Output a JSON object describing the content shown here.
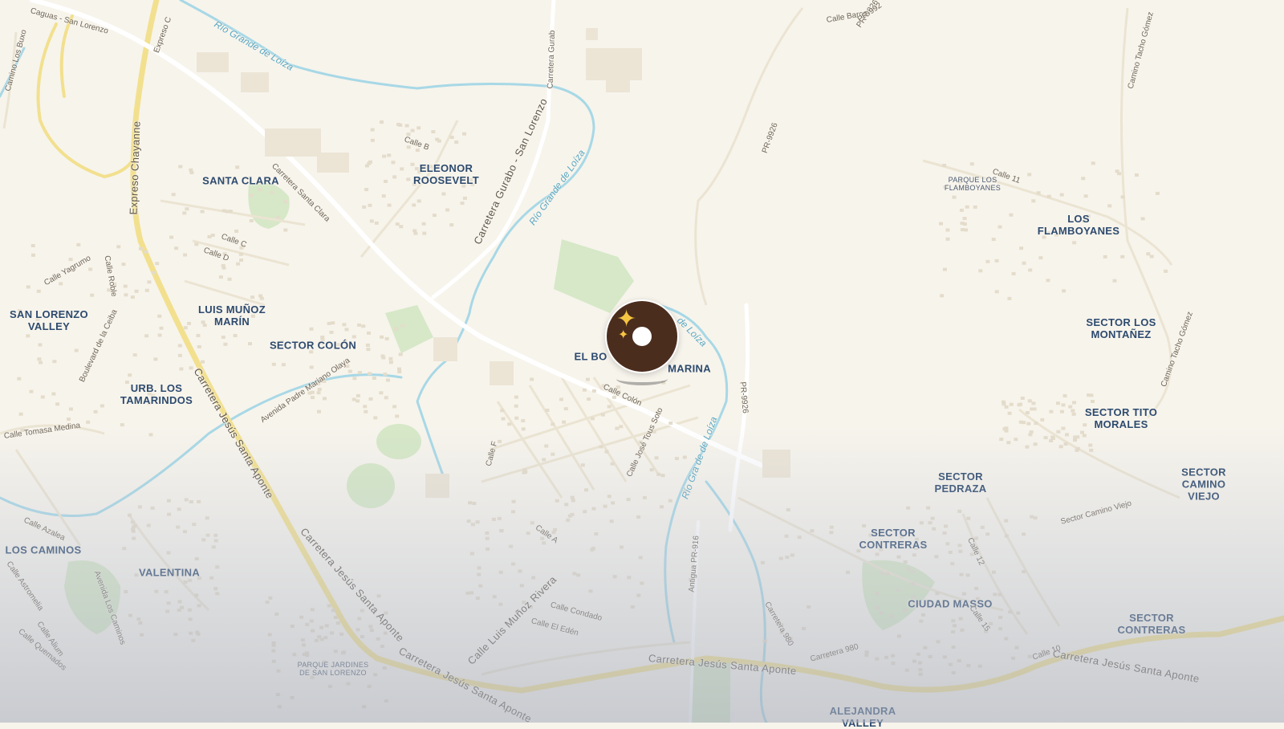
{
  "map": {
    "colors": {
      "land": "#f7f4ec",
      "highway": "#f2e08e",
      "water": "#a7d8e6",
      "park": "#d6e8c7",
      "label": "#2d4a6e",
      "marker": "#4b2d1e"
    },
    "marker": {
      "icon": "sparkles-icon"
    },
    "places": [
      {
        "id": "santa-clara",
        "text": "SANTA CLARA"
      },
      {
        "id": "eleonor-roosevelt",
        "text": "ELEONOR\nROOSEVELT"
      },
      {
        "id": "san-lorenzo-valley",
        "text": "SAN LORENZO\nVALLEY"
      },
      {
        "id": "luis-munoz-marin",
        "text": "LUIS MUÑOZ\nMARÍN"
      },
      {
        "id": "sector-colon",
        "text": "SECTOR COLÓN"
      },
      {
        "id": "urb-los-tamarindos",
        "text": "URB. LOS\nTAMARINDOS"
      },
      {
        "id": "el-bo",
        "text": "EL BO"
      },
      {
        "id": "marina",
        "text": "MARINA"
      },
      {
        "id": "parque-los-flamboyanes",
        "text": "PARQUE LOS\nFLAMBOYANES"
      },
      {
        "id": "los-flamboyanes",
        "text": "LOS\nFLAMBOYANES"
      },
      {
        "id": "sector-los-montanez",
        "text": "SECTOR LOS\nMONTAÑEZ"
      },
      {
        "id": "sector-tito-morales",
        "text": "SECTOR TITO\nMORALES"
      },
      {
        "id": "sector-pedraza",
        "text": "SECTOR\nPEDRAZA"
      },
      {
        "id": "sector-camino-viejo",
        "text": "SECTOR CAMINO\nVIEJO"
      },
      {
        "id": "sector-contreras-1",
        "text": "SECTOR\nCONTRERAS"
      },
      {
        "id": "ciudad-masso",
        "text": "CIUDAD MASSO"
      },
      {
        "id": "sector-contreras-2",
        "text": "SECTOR\nCONTRERAS"
      },
      {
        "id": "los-caminos",
        "text": "LOS CAMINOS"
      },
      {
        "id": "valentina",
        "text": "VALENTINA"
      },
      {
        "id": "parque-jardines",
        "text": "PARQUE JARDINES\nDE SAN LORENZO"
      },
      {
        "id": "alejandra-valley",
        "text": "ALEJANDRA\nVALLEY"
      }
    ],
    "streets": [
      {
        "id": "caguas-san-lorenzo",
        "text": "Caguas - San Lorenzo"
      },
      {
        "id": "expreso-top",
        "text": "Expreso C"
      },
      {
        "id": "rio-grande-loiza-1",
        "text": "Río Grande de Loíza"
      },
      {
        "id": "carretera-gurabo-top",
        "text": "Carretera Gurab"
      },
      {
        "id": "pr-9926-top",
        "text": "PR-9926"
      },
      {
        "id": "pr-9926-mid",
        "text": "PR-9926"
      },
      {
        "id": "expreso-chayanne",
        "text": "Expreso Chayanne"
      },
      {
        "id": "carretera-santa-clara",
        "text": "Carretera Santa Clara"
      },
      {
        "id": "carretera-gurabo-san-lorenzo",
        "text": "Carretera Gurabo - San Lorenzo"
      },
      {
        "id": "rio-grande-loiza-2",
        "text": "Río Grande de Loíza"
      },
      {
        "id": "de-loiza",
        "text": "de Loíza"
      },
      {
        "id": "pr-9926-right",
        "text": "PR-9926"
      },
      {
        "id": "calle-colon",
        "text": "Calle Colón"
      },
      {
        "id": "calle-jose-tous-soto",
        "text": "Calle José Tous Soto"
      },
      {
        "id": "rio-gra-de-loiza",
        "text": "Río Gra  de de Loíza"
      },
      {
        "id": "carretera-jesus-santa-aponte-1",
        "text": "Carretera Jesús Santa Aponte"
      },
      {
        "id": "carretera-jesus-santa-aponte-2",
        "text": "Carretera Jesús Santa Aponte"
      },
      {
        "id": "carretera-jesus-santa-aponte-3",
        "text": "Carretera Jesús Santa Aponte"
      },
      {
        "id": "carretera-jesus-santa-aponte-4",
        "text": "Carretera Jesús Santa Aponte"
      },
      {
        "id": "carretera-jesus-santa-aponte-5",
        "text": "Carretera Jesús Santa Aponte"
      },
      {
        "id": "avenida-padre-mariano-olaya",
        "text": "Avenida Padre Mariano Olaya"
      },
      {
        "id": "calle-tomasa-medina",
        "text": "Calle Tomasa Medina"
      },
      {
        "id": "boulevard-de-la-ceiba",
        "text": "Boulevard de la Ceiba"
      },
      {
        "id": "calle-luis-munoz-rivera",
        "text": "Calle Luis Muñoz Rivera"
      },
      {
        "id": "calle-condado",
        "text": "Calle Condado"
      },
      {
        "id": "calle-el-eden",
        "text": "Calle El Edén"
      },
      {
        "id": "antigua-pr-916",
        "text": "Antigua PR-916"
      },
      {
        "id": "carretera-980-1",
        "text": "Carretera 980"
      },
      {
        "id": "carretera-980-2",
        "text": "Carretera 980"
      },
      {
        "id": "sector-camino-viejo-road",
        "text": "Sector Camino Viejo"
      },
      {
        "id": "camino-tacho-gomez-1",
        "text": "Camino Tacho Gómez"
      },
      {
        "id": "camino-tacho-gomez-2",
        "text": "Camino Tacho Gómez"
      },
      {
        "id": "camino-los-buxo",
        "text": "Camino Los Buxo"
      },
      {
        "id": "calle-yagrumo",
        "text": "Calle Yagrumo"
      },
      {
        "id": "calle-roble",
        "text": "Calle Roble"
      },
      {
        "id": "calle-azalea",
        "text": "Calle Azalea"
      },
      {
        "id": "calle-astromelia",
        "text": "Calle Astromelia"
      },
      {
        "id": "calle-alium",
        "text": "Calle Alium"
      },
      {
        "id": "calle-quemados",
        "text": "Calle Quemados"
      },
      {
        "id": "avenida-los-caminos",
        "text": "Avenida Los Caminos"
      },
      {
        "id": "calle-barce",
        "text": "Calle Barce"
      },
      {
        "id": "pr-992",
        "text": "PR-992"
      },
      {
        "id": "calle-b",
        "text": "Calle B"
      },
      {
        "id": "calle-c",
        "text": "Calle C"
      },
      {
        "id": "calle-d",
        "text": "Calle D"
      },
      {
        "id": "calle-a",
        "text": "Calle A"
      },
      {
        "id": "calle-f",
        "text": "Calle F"
      },
      {
        "id": "calle-11",
        "text": "Calle 11"
      },
      {
        "id": "calle-12",
        "text": "Calle 12"
      },
      {
        "id": "calle-15",
        "text": "Calle 15"
      },
      {
        "id": "calle-10",
        "text": "Calle 10"
      }
    ]
  }
}
